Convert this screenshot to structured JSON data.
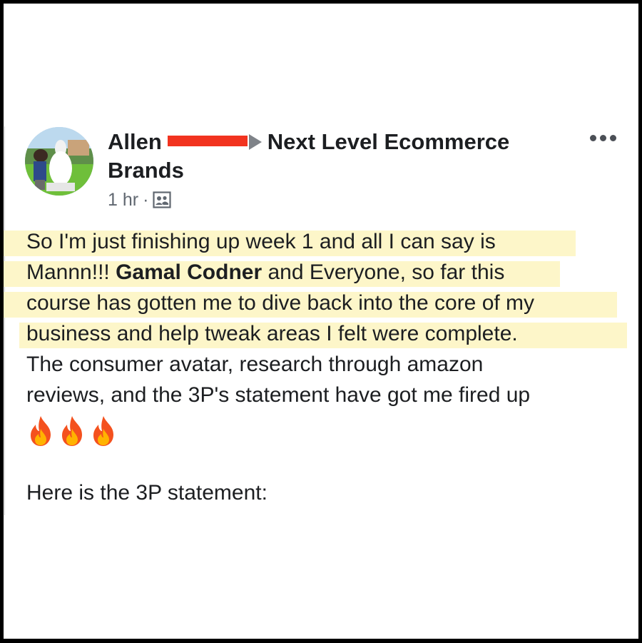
{
  "post": {
    "author_first": "Allen",
    "group_name_line1": "Next Level Ecommerce",
    "group_name_line2": "Brands",
    "time": "1 hr",
    "separator": "·",
    "audience_icon": "group-members-icon",
    "more_icon": "more-dots-icon"
  },
  "content": {
    "line1": "So I'm just finishing up week 1 and all I can say is",
    "line2_before": "Mannn!!! ",
    "line2_mention": "Gamal Codner",
    "line2_after": " and Everyone, so far this",
    "line3": "course has gotten me to dive back into the core of my",
    "line4": "business and help tweak areas I felt were complete.",
    "line5": "The consumer avatar, research through amazon",
    "line6": "reviews, and the 3P's statement have got me fired up",
    "emoji": [
      "🔥",
      "🔥",
      "🔥"
    ],
    "footer": "Here is the 3P statement:"
  },
  "colors": {
    "highlight": "#fdf6c9",
    "redaction": "#f2331f",
    "text": "#1c1e21",
    "meta": "#606770"
  }
}
